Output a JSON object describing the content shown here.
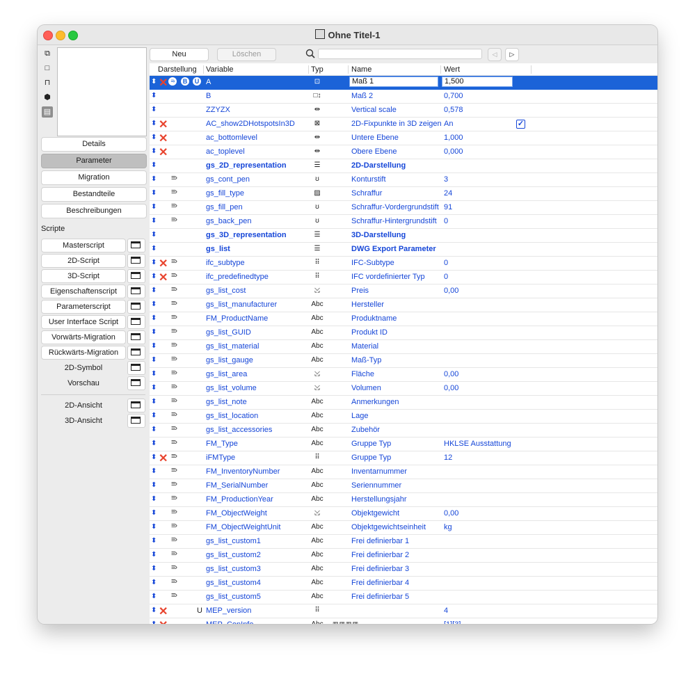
{
  "window": {
    "title": "Ohne Titel-1"
  },
  "sidebar": {
    "mode_icons": [
      "layout-icon",
      "square-icon",
      "stand-icon",
      "cube-icon",
      "film-icon"
    ],
    "nav": [
      "Details",
      "Parameter",
      "Migration",
      "Bestandteile",
      "Beschreibungen"
    ],
    "active_nav": "Parameter",
    "scripts_label": "Scripte",
    "scripts": [
      "Masterscript",
      "2D-Script",
      "3D-Script",
      "Eigenschaftenscript",
      "Parameterscript",
      "User Interface Script",
      "Vorwärts-Migration",
      "Rückwärts-Migration",
      "2D-Symbol",
      "Vorschau"
    ],
    "views": [
      "2D-Ansicht",
      "3D-Ansicht"
    ]
  },
  "toolbar": {
    "new_label": "Neu",
    "delete_label": "Löschen",
    "search_placeholder": ""
  },
  "table": {
    "headers": {
      "darstellung": "Darstellung",
      "variable": "Variable",
      "typ": "Typ",
      "name": "Name",
      "wert": "Wert"
    },
    "rows": [
      {
        "x": true,
        "list": true,
        "bu": true,
        "variable": "A",
        "typ": "⊡",
        "name": "Maß 1",
        "wert": "1,500",
        "selected": true
      },
      {
        "variable": "B",
        "typ": "□↕",
        "name": "Maß 2",
        "wert": "0,700"
      },
      {
        "variable": "ZZYZX",
        "typ": "⇹",
        "name": "Vertical scale",
        "wert": "0,578"
      },
      {
        "x": true,
        "variable": "AC_show2DHotspotsIn3D",
        "typ": "⊠",
        "name": "2D-Fixpunkte in 3D zeigen",
        "wert": "An",
        "checkbox": true
      },
      {
        "x": true,
        "variable": "ac_bottomlevel",
        "typ": "⇹",
        "name": "Untere Ebene",
        "wert": "1,000"
      },
      {
        "x": true,
        "variable": "ac_toplevel",
        "typ": "⇹",
        "name": "Obere Ebene",
        "wert": "0,000"
      },
      {
        "variable": "gs_2D_representation",
        "typ": "☰",
        "name": "2D-Darstellung",
        "wert": "",
        "bold": true
      },
      {
        "list": true,
        "variable": "gs_cont_pen",
        "typ": "ʊ",
        "name": "Konturstift",
        "wert": "3"
      },
      {
        "list": true,
        "variable": "gs_fill_type",
        "typ": "▨",
        "name": "Schraffur",
        "wert": "24"
      },
      {
        "list": true,
        "variable": "gs_fill_pen",
        "typ": "ʊ",
        "name": "Schraffur-Vordergrundstift",
        "wert": "91"
      },
      {
        "list": true,
        "variable": "gs_back_pen",
        "typ": "ʊ",
        "name": "Schraffur-Hintergrundstift",
        "wert": "0"
      },
      {
        "variable": "gs_3D_representation",
        "typ": "☰",
        "name": "3D-Darstellung",
        "wert": "",
        "bold": true
      },
      {
        "variable": "gs_list",
        "typ": "☰",
        "name": "DWG Export Parameter",
        "wert": "",
        "bold": true
      },
      {
        "x": true,
        "list": true,
        "variable": "ifc_subtype",
        "typ": "⠿",
        "name": "IFC-Subtype",
        "wert": "0"
      },
      {
        "x": true,
        "list": true,
        "variable": "ifc_predefinedtype",
        "typ": "⠿",
        "name": "IFC vordefinierter Typ",
        "wert": "0"
      },
      {
        "list": true,
        "variable": "gs_list_cost",
        "typ": "⤩",
        "name": "Preis",
        "wert": "0,00"
      },
      {
        "list": true,
        "variable": "gs_list_manufacturer",
        "typ": "Abc",
        "name": "Hersteller",
        "wert": ""
      },
      {
        "list": true,
        "variable": "FM_ProductName",
        "typ": "Abc",
        "name": "Produktname",
        "wert": ""
      },
      {
        "list": true,
        "variable": "gs_list_GUID",
        "typ": "Abc",
        "name": "Produkt ID",
        "wert": ""
      },
      {
        "list": true,
        "variable": "gs_list_material",
        "typ": "Abc",
        "name": "Material",
        "wert": ""
      },
      {
        "list": true,
        "variable": "gs_list_gauge",
        "typ": "Abc",
        "name": "Maß-Typ",
        "wert": ""
      },
      {
        "list": true,
        "variable": "gs_list_area",
        "typ": "⤩",
        "name": "Fläche",
        "wert": "0,00"
      },
      {
        "list": true,
        "variable": "gs_list_volume",
        "typ": "⤩",
        "name": "Volumen",
        "wert": "0,00"
      },
      {
        "list": true,
        "variable": "gs_list_note",
        "typ": "Abc",
        "name": "Anmerkungen",
        "wert": ""
      },
      {
        "list": true,
        "variable": "gs_list_location",
        "typ": "Abc",
        "name": "Lage",
        "wert": ""
      },
      {
        "list": true,
        "variable": "gs_list_accessories",
        "typ": "Abc",
        "name": "Zubehör",
        "wert": ""
      },
      {
        "list": true,
        "variable": "FM_Type",
        "typ": "Abc",
        "name": "Gruppe Typ",
        "wert": "HKLSE Ausstattung"
      },
      {
        "x": true,
        "list": true,
        "variable": "iFMType",
        "typ": "⠿",
        "name": "Gruppe Typ",
        "wert": "12"
      },
      {
        "list": true,
        "variable": "FM_InventoryNumber",
        "typ": "Abc",
        "name": "Inventarnummer",
        "wert": ""
      },
      {
        "list": true,
        "variable": "FM_SerialNumber",
        "typ": "Abc",
        "name": "Seriennummer",
        "wert": ""
      },
      {
        "list": true,
        "variable": "FM_ProductionYear",
        "typ": "Abc",
        "name": "Herstellungsjahr",
        "wert": ""
      },
      {
        "list": true,
        "variable": "FM_ObjectWeight",
        "typ": "⤩",
        "name": "Objektgewicht",
        "wert": "0,00"
      },
      {
        "list": true,
        "variable": "FM_ObjectWeightUnit",
        "typ": "Abc",
        "name": "Objektgewichtseinheit",
        "wert": "kg"
      },
      {
        "list": true,
        "variable": "gs_list_custom1",
        "typ": "Abc",
        "name": "Frei definierbar 1",
        "wert": ""
      },
      {
        "list": true,
        "variable": "gs_list_custom2",
        "typ": "Abc",
        "name": "Frei definierbar 2",
        "wert": ""
      },
      {
        "list": true,
        "variable": "gs_list_custom3",
        "typ": "Abc",
        "name": "Frei definierbar 3",
        "wert": ""
      },
      {
        "list": true,
        "variable": "gs_list_custom4",
        "typ": "Abc",
        "name": "Frei definierbar 4",
        "wert": ""
      },
      {
        "list": true,
        "variable": "gs_list_custom5",
        "typ": "Abc",
        "name": "Frei definierbar 5",
        "wert": ""
      },
      {
        "x": true,
        "u": "U",
        "variable": "MEP_version",
        "typ": "⠿",
        "name": "",
        "wert": "4"
      },
      {
        "x": true,
        "variable": "MEP_ConInfo",
        "typ": "Abc",
        "extra": "▥▥▥▥",
        "name": "",
        "wert": "[1][3]"
      }
    ]
  },
  "colors": {
    "accent": "#1b63d8",
    "link_text": "#1546d8",
    "delete_x": "#e8432d"
  }
}
